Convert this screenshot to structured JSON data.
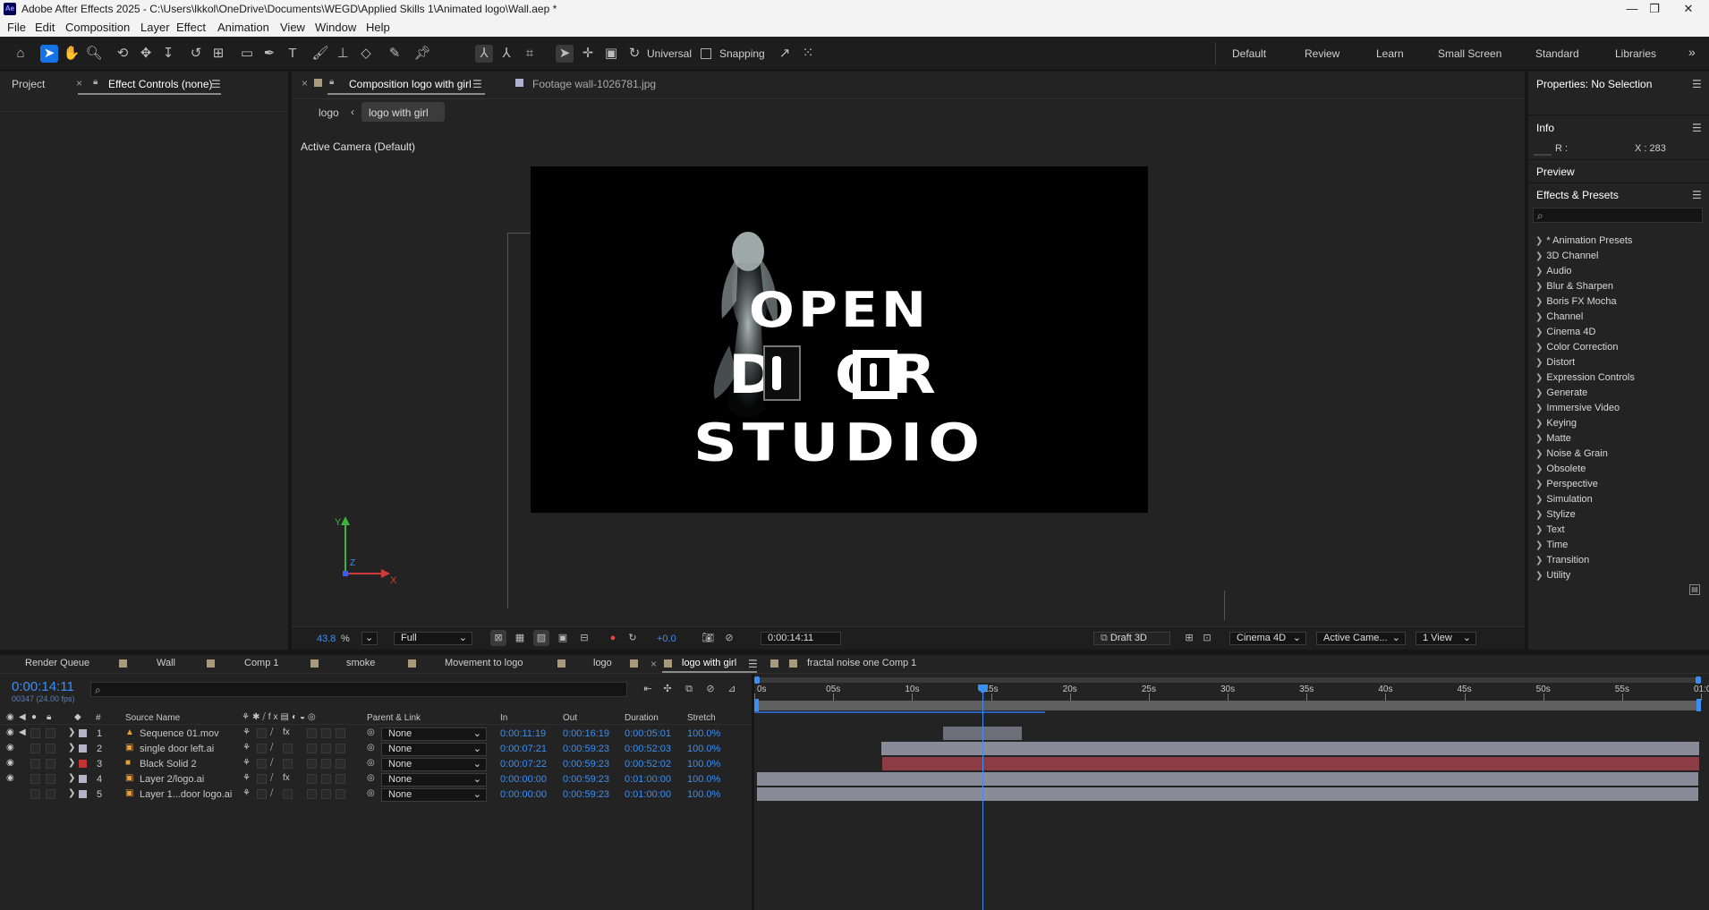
{
  "window": {
    "title": "Adobe After Effects 2025 - C:\\Users\\lkkol\\OneDrive\\Documents\\WEGD\\Applied Skills 1\\Animated logo\\Wall.aep *",
    "app_badge": "Ae",
    "controls": {
      "minimize": "—",
      "maximize": "❐",
      "close": "✕"
    }
  },
  "menu": [
    "File",
    "Edit",
    "Composition",
    "Layer",
    "Effect",
    "Animation",
    "View",
    "Window",
    "Help"
  ],
  "toolbar": {
    "universal_label": "Universal",
    "snapping_label": "Snapping",
    "workspaces": [
      "Default",
      "Review",
      "Learn",
      "Small Screen",
      "Standard",
      "Libraries"
    ],
    "overflow": "»"
  },
  "left_panel": {
    "tabs": [
      "Project",
      "Effect Controls (none)"
    ],
    "close": "×",
    "menu": "☰"
  },
  "comp_panel": {
    "tabs": [
      "Composition logo with girl",
      "Footage wall-1026781.jpg"
    ],
    "close": "×",
    "menu": "☰",
    "breadcrumbs": [
      "logo",
      "logo with girl"
    ],
    "crumb_sep": "‹",
    "camera_label": "Active Camera (Default)",
    "logo_lines": [
      "OPEN",
      "D  OR",
      "STUDIO"
    ],
    "axis": {
      "y": "Y",
      "z": "Z",
      "x": "X"
    },
    "bottom": {
      "zoom": "43.8",
      "zoom_unit": "%",
      "resolution": "Full",
      "exposure": "+0.0",
      "timecode": "0:00:14:11",
      "draft3d": "Draft 3D",
      "renderer": "Cinema 4D",
      "camera": "Active Came...",
      "views": "1 View"
    }
  },
  "right_panel": {
    "properties_title": "Properties: No Selection",
    "info_title": "Info",
    "info_r": "R :",
    "info_x": "X : 283",
    "preview_title": "Preview",
    "effects_title": "Effects & Presets",
    "search_icon": "⌕",
    "menu": "☰",
    "effects": [
      "* Animation Presets",
      "3D Channel",
      "Audio",
      "Blur & Sharpen",
      "Boris FX Mocha",
      "Channel",
      "Cinema 4D",
      "Color Correction",
      "Distort",
      "Expression Controls",
      "Generate",
      "Immersive Video",
      "Keying",
      "Matte",
      "Noise & Grain",
      "Obsolete",
      "Perspective",
      "Simulation",
      "Stylize",
      "Text",
      "Time",
      "Transition",
      "Utility"
    ]
  },
  "timeline": {
    "tabs": [
      {
        "label": "Render Queue",
        "color": ""
      },
      {
        "label": "Wall",
        "color": "#a89a7a"
      },
      {
        "label": "Comp 1",
        "color": "#a89a7a"
      },
      {
        "label": "smoke",
        "color": "#a89a7a"
      },
      {
        "label": "Movement to logo",
        "color": "#a89a7a"
      },
      {
        "label": "logo",
        "color": "#a89a7a"
      },
      {
        "label": "logo with girl",
        "color": "#a89a7a"
      },
      {
        "label": "fractal noise one Comp 1",
        "color": "#a89a7a"
      }
    ],
    "close": "×",
    "menu": "☰",
    "timecode": "0:00:14:11",
    "frames": "00347 (24.00 fps)",
    "search_icon": "⌕",
    "columns": {
      "num": "#",
      "source": "Source Name",
      "parent": "Parent & Link",
      "in": "In",
      "out": "Out",
      "duration": "Duration",
      "stretch": "Stretch"
    },
    "ruler": [
      "0s",
      "05s",
      "10s",
      "15s",
      "20s",
      "25s",
      "30s",
      "35s",
      "40s",
      "45s",
      "50s",
      "55s",
      "01:0"
    ],
    "playhead_seconds": 14.46,
    "timeline_seconds": 60,
    "layers": [
      {
        "num": "1",
        "name": "Sequence 01.mov",
        "label_color": "#b4b4c8",
        "icon": "▲",
        "parent": "None",
        "in": "0:00:11:19",
        "out": "0:00:16:19",
        "duration": "0:00:05:01",
        "stretch": "100.0%",
        "start": 11.79,
        "end": 16.79,
        "bar_color": "#6e6e7a",
        "fx": true,
        "eye": true,
        "audio": true
      },
      {
        "num": "2",
        "name": "single door left.ai",
        "label_color": "#b4b4c8",
        "icon": "▣",
        "parent": "None",
        "in": "0:00:07:21",
        "out": "0:00:59:23",
        "duration": "0:00:52:03",
        "stretch": "100.0%",
        "start": 7.88,
        "end": 60,
        "bar_color": "#8a8a98",
        "fx": false,
        "eye": true,
        "audio": false
      },
      {
        "num": "3",
        "name": "Black Solid 2",
        "label_color": "#c03434",
        "icon": "■",
        "parent": "None",
        "in": "0:00:07:22",
        "out": "0:00:59:23",
        "duration": "0:00:52:02",
        "stretch": "100.0%",
        "start": 7.92,
        "end": 60,
        "bar_color": "#8c3c44",
        "fx": false,
        "eye": true,
        "audio": false
      },
      {
        "num": "4",
        "name": "Layer 2/logo.ai",
        "label_color": "#b4b4c8",
        "icon": "▣",
        "parent": "None",
        "in": "0:00:00:00",
        "out": "0:00:59:23",
        "duration": "0:01:00:00",
        "stretch": "100.0%",
        "start": 0,
        "end": 60,
        "bar_color": "#8a8a98",
        "fx": true,
        "eye": true,
        "audio": false
      },
      {
        "num": "5",
        "name": "Layer 1...door logo.ai",
        "label_color": "#b4b4c8",
        "icon": "▣",
        "parent": "None",
        "in": "0:00:00:00",
        "out": "0:00:59:23",
        "duration": "0:01:00:00",
        "stretch": "100.0%",
        "start": 0,
        "end": 60,
        "bar_color": "#8a8a98",
        "fx": false,
        "eye": false,
        "audio": false
      }
    ]
  }
}
